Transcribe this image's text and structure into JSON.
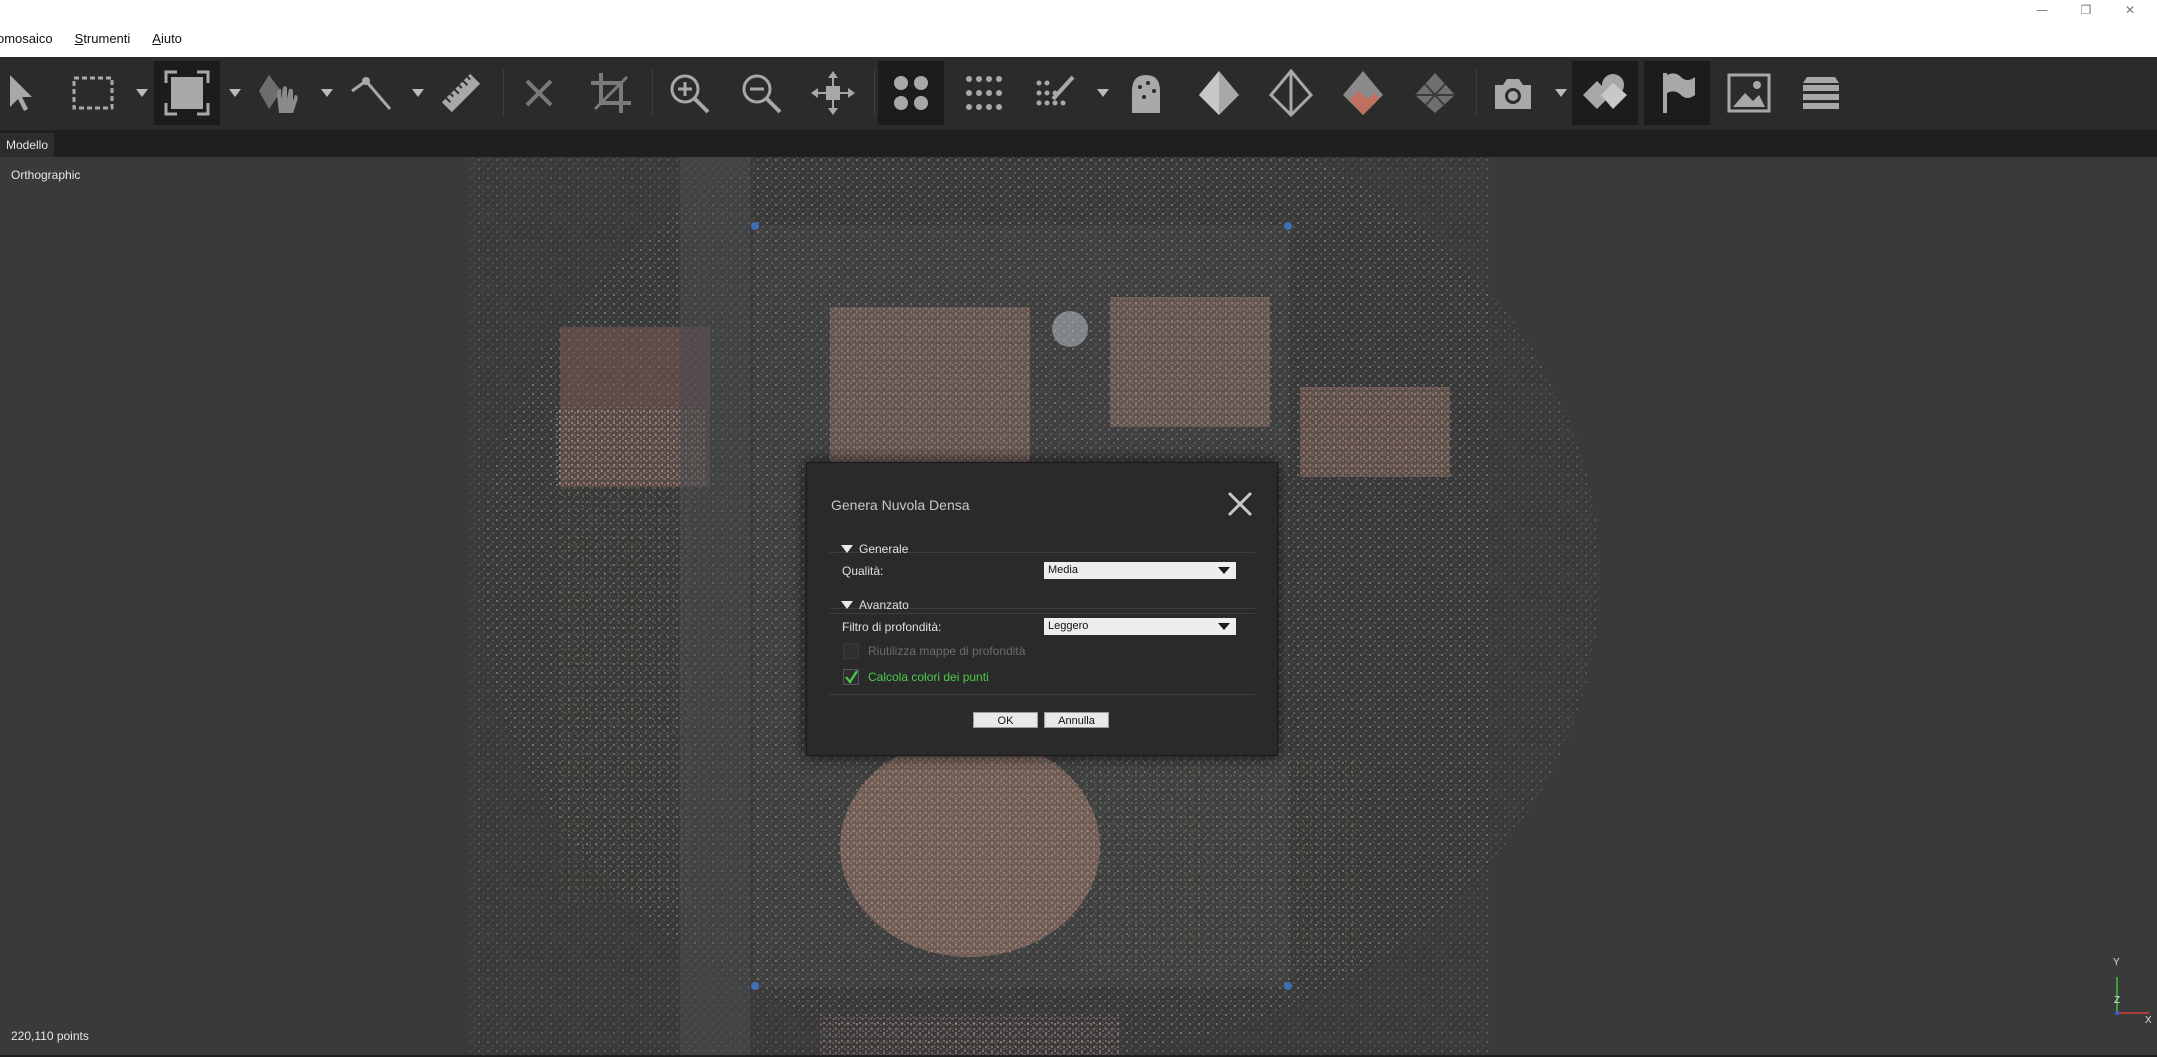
{
  "menubar": {
    "items": [
      {
        "pre": "",
        "accel": "",
        "rest": "omosaico"
      },
      {
        "pre": "",
        "accel": "S",
        "rest": "trumenti"
      },
      {
        "pre": "",
        "accel": "A",
        "rest": "iuto"
      }
    ]
  },
  "toolbar": {
    "icons": [
      "select-pointer-icon",
      "rectangle-select-icon",
      "resize-region-icon",
      "navigation-hand-icon",
      "ruler-measure-icon",
      "ruler-icon",
      "delete-selection-icon",
      "crop-icon",
      "zoom-in-icon",
      "zoom-out-icon",
      "reset-view-icon",
      "point-cloud-icon",
      "sparse-points-icon",
      "brush-points-icon",
      "dense-cloud-icon",
      "shaded-model-icon",
      "wireframe-model-icon",
      "textured-model-icon",
      "tiled-model-icon",
      "camera-icon",
      "shapes-icon",
      "markers-flag-icon",
      "image-icon",
      "layers-icon"
    ]
  },
  "tabs": {
    "active": "Modello"
  },
  "viewport": {
    "projection": "Orthographic",
    "points_count": "220,110 points",
    "axis_labels": {
      "y": "Y",
      "z": "Z",
      "x": "X"
    }
  },
  "dialog": {
    "title": "Genera Nuvola Densa",
    "sections": {
      "general": {
        "title": "Generale",
        "quality_label": "Qualità:",
        "quality_value": "Media"
      },
      "advanced": {
        "title": "Avanzato",
        "depth_filter_label": "Filtro di profondità:",
        "depth_filter_value": "Leggero",
        "reuse_depth_maps_label": "Riutilizza mappe di profondità",
        "reuse_depth_maps_checked": false,
        "compute_colors_label": "Calcola colori dei punti",
        "compute_colors_checked": true
      }
    },
    "ok_label": "OK",
    "cancel_label": "Annulla"
  },
  "colors": {
    "toolbar_bg": "#2b2b2b",
    "viewport_bg": "#3a3a3a",
    "dialog_bg": "#2a2a2a",
    "icon_fill": "#a8a8a8",
    "checked_label": "#4dcc4d",
    "disabled_label": "#6c6c6c"
  }
}
